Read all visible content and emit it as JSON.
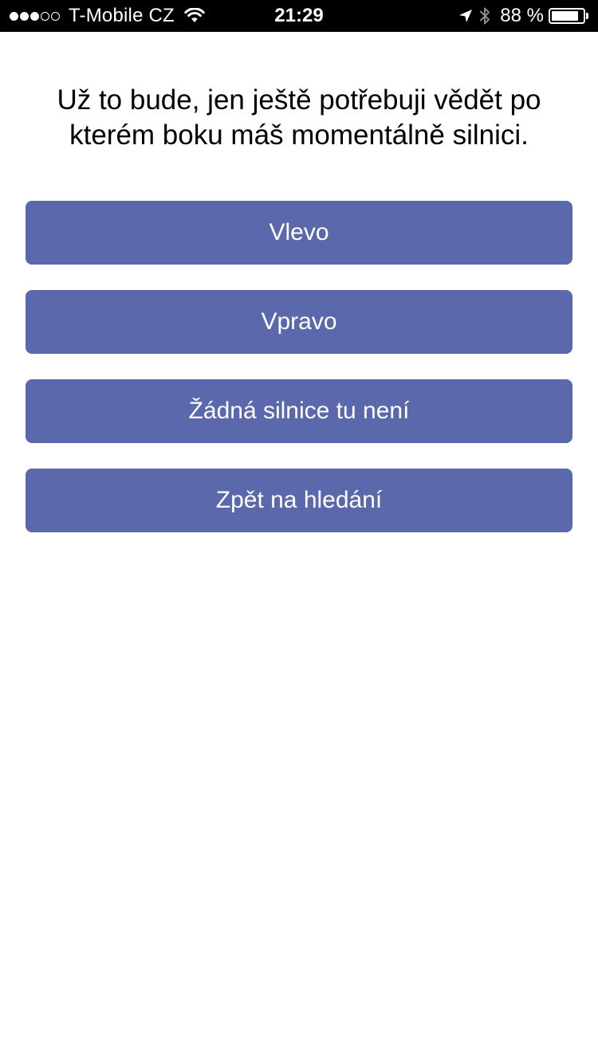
{
  "status_bar": {
    "signal_filled": 3,
    "signal_total": 5,
    "carrier": "T-Mobile CZ",
    "time": "21:29",
    "battery_percent_text": "88 %",
    "battery_level": 0.88,
    "icons": [
      "signal-dots",
      "wifi-icon",
      "location-arrow-icon",
      "bluetooth-icon",
      "battery-icon"
    ]
  },
  "question": "Už to bude, jen ještě potřebuji vědět po kterém boku máš momentálně silnici.",
  "options": {
    "left": "Vlevo",
    "right": "Vpravo",
    "none": "Žádná silnice tu není",
    "back": "Zpět na hledání"
  },
  "colors": {
    "button_bg": "#5b68ab",
    "button_text": "#ffffff",
    "status_bar_bg": "#000000"
  }
}
